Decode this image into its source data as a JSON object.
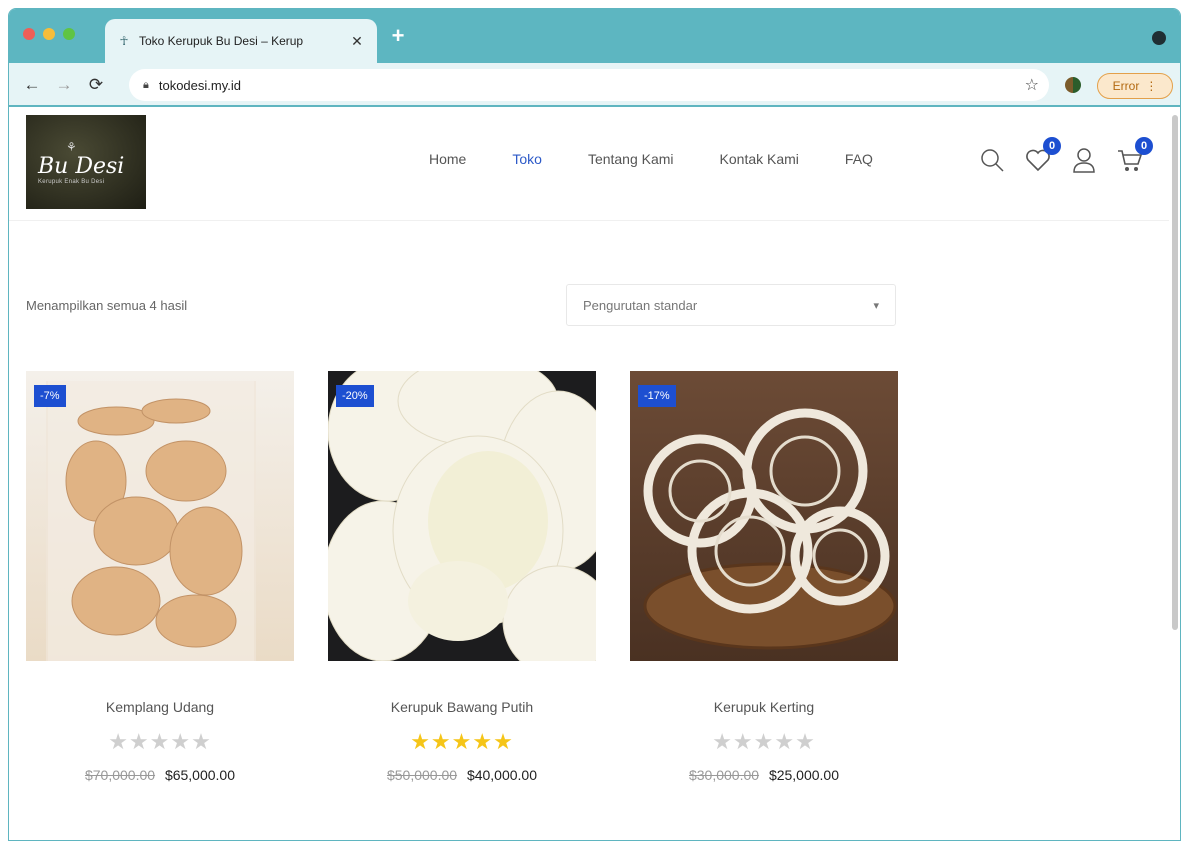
{
  "browser": {
    "tab_title": "Toko Kerupuk Bu Desi – Kerup",
    "url": "tokodesi.my.id",
    "error_label": "Error"
  },
  "site": {
    "logo_text": "Bu Desi",
    "logo_sub": "Kerupuk Enak Bu Desi",
    "nav": [
      {
        "label": "Home",
        "active": false
      },
      {
        "label": "Toko",
        "active": true
      },
      {
        "label": "Tentang Kami",
        "active": false
      },
      {
        "label": "Kontak Kami",
        "active": false
      },
      {
        "label": "FAQ",
        "active": false
      }
    ],
    "wishlist_count": "0",
    "cart_count": "0"
  },
  "shop": {
    "result_count": "Menampilkan semua 4 hasil",
    "sort_selected": "Pengurutan standar"
  },
  "products": [
    {
      "name": "Kemplang Udang",
      "badge": "-7%",
      "old_price": "$70,000.00",
      "price": "$65,000.00",
      "rating": 0
    },
    {
      "name": "Kerupuk Bawang Putih",
      "badge": "-20%",
      "old_price": "$50,000.00",
      "price": "$40,000.00",
      "rating": 5
    },
    {
      "name": "Kerupuk Kerting",
      "badge": "-17%",
      "old_price": "$30,000.00",
      "price": "$25,000.00",
      "rating": 0
    }
  ],
  "colors": {
    "accent": "#1d4fd1",
    "star": "#f5c518",
    "chrome": "#5db6c1"
  }
}
